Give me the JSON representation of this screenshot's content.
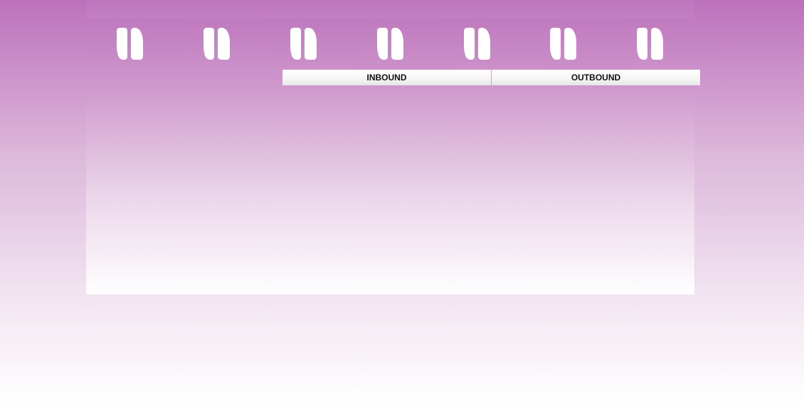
{
  "icons": [
    {
      "name": "pause-icon"
    },
    {
      "name": "pause-icon"
    },
    {
      "name": "pause-icon"
    },
    {
      "name": "pause-icon"
    },
    {
      "name": "pause-icon"
    },
    {
      "name": "pause-icon"
    },
    {
      "name": "pause-icon"
    }
  ],
  "tabs": {
    "inbound_label": "INBOUND",
    "outbound_label": "OUTBOUND"
  },
  "colors": {
    "background_top": "#bc71bb",
    "background_bottom": "#ffffff",
    "icon_fill": "#ffffff"
  }
}
